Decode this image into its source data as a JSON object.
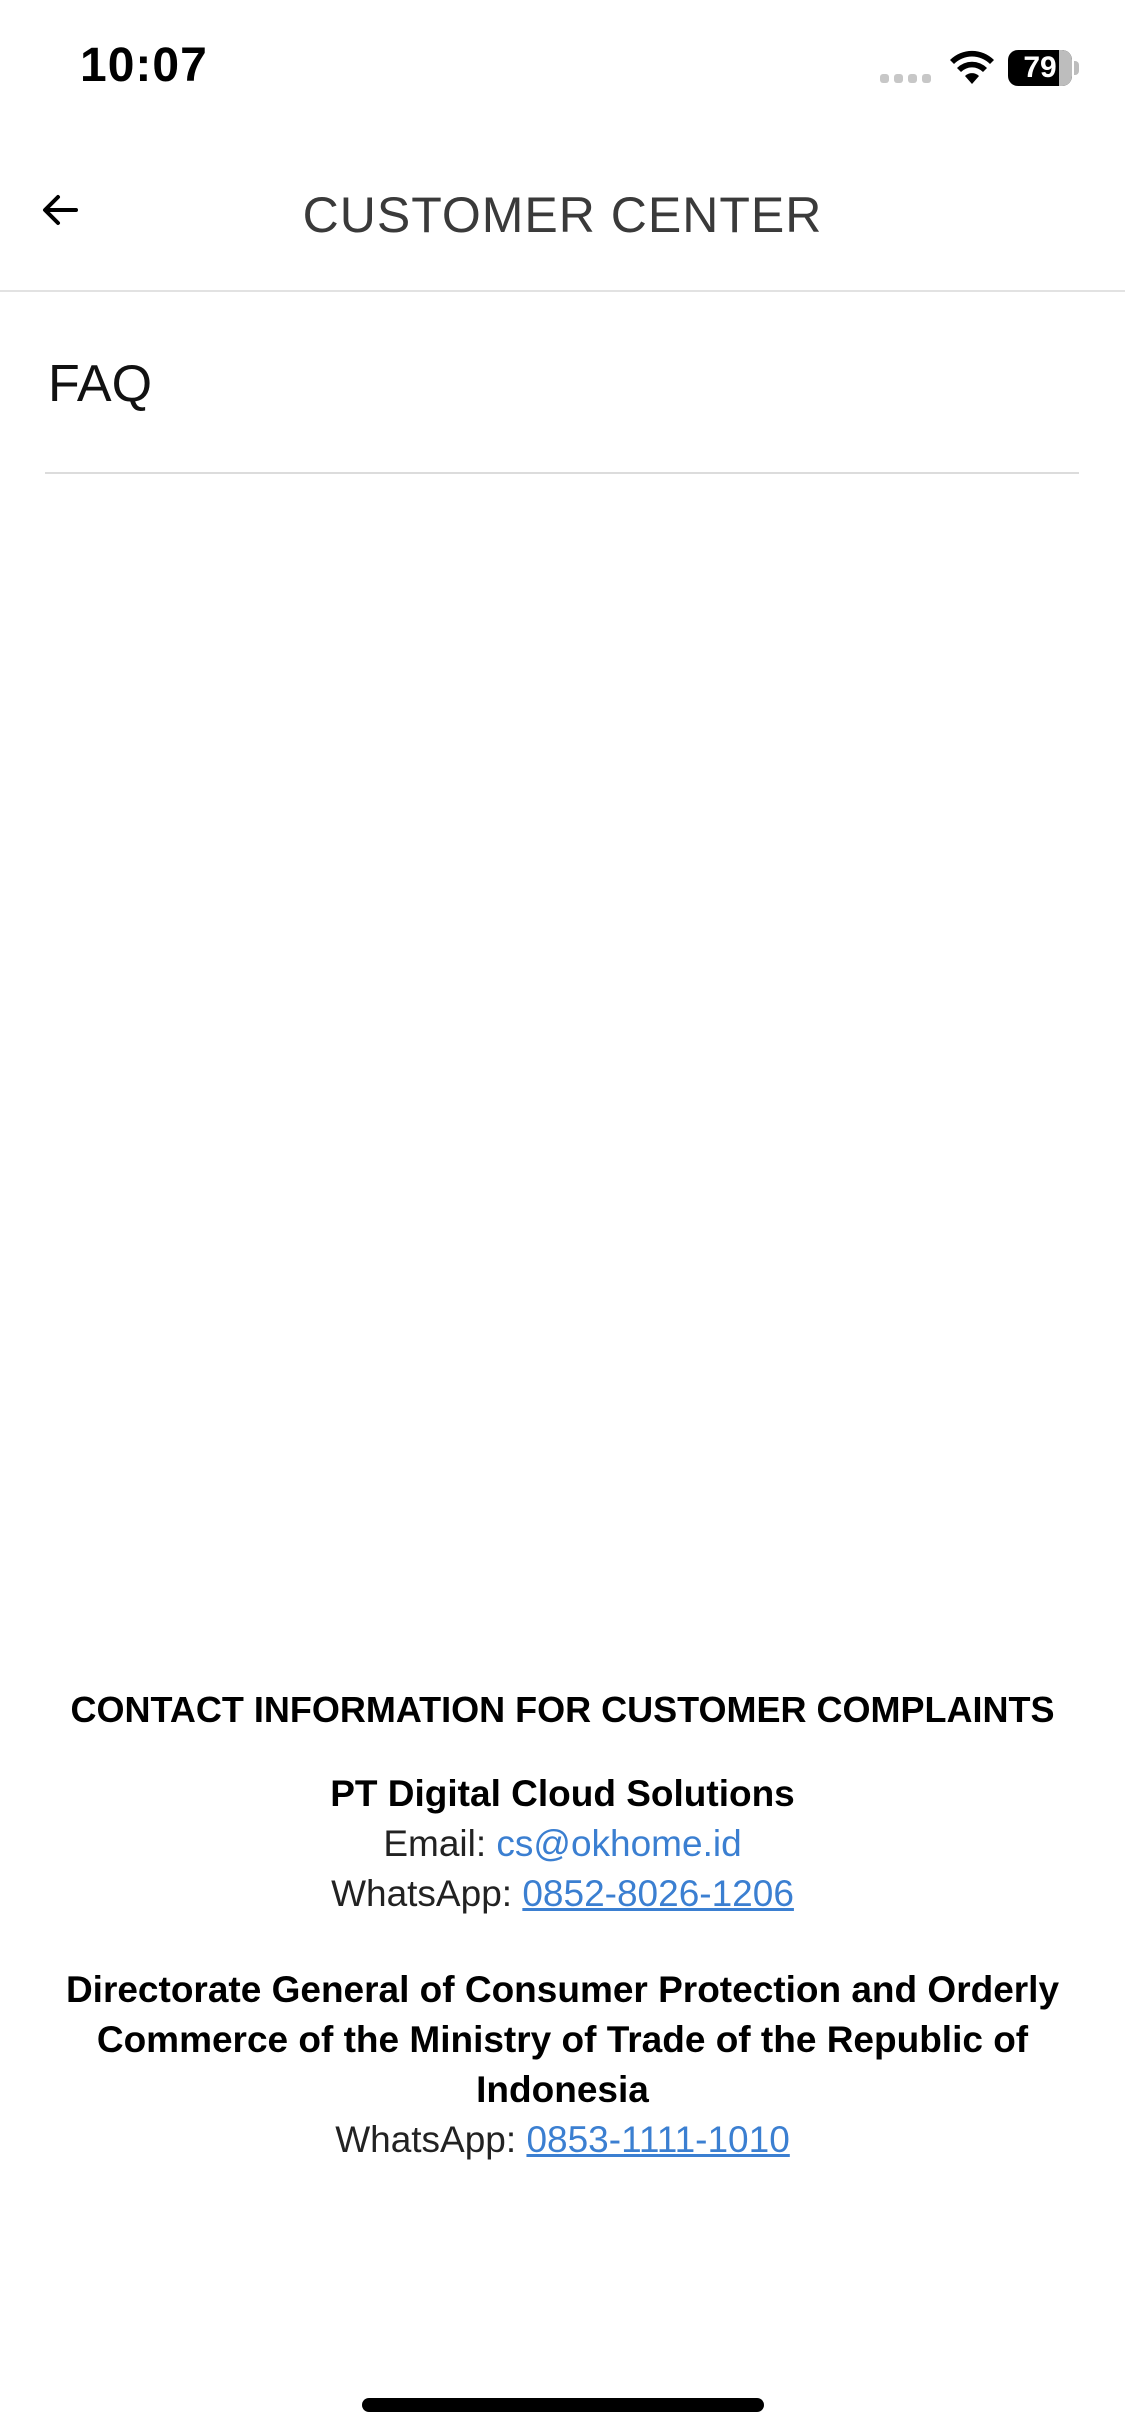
{
  "status_bar": {
    "time": "10:07",
    "battery_level": "79",
    "battery_fraction": 0.79
  },
  "header": {
    "title": "CUSTOMER CENTER",
    "back_icon": "arrow-left-icon"
  },
  "faq": {
    "label": "FAQ"
  },
  "contact": {
    "heading": "CONTACT INFORMATION FOR CUSTOMER COMPLAINTS",
    "company": {
      "name": "PT Digital Cloud Solutions",
      "email_label": "Email: ",
      "email": "cs@okhome.id",
      "whatsapp_label": "WhatsApp: ",
      "whatsapp": "0852-8026-1206"
    },
    "government": {
      "name": "Directorate General of Consumer Protection and Orderly Commerce of the Ministry of Trade of the Republic of Indonesia",
      "whatsapp_label": "WhatsApp: ",
      "whatsapp": "0853-1111-1010"
    }
  },
  "colors": {
    "link": "#3b7fd1",
    "divider": "#dcdcdc",
    "title": "#3a3a3a"
  }
}
